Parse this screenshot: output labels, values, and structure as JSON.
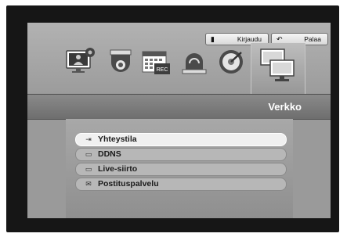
{
  "header": {
    "login_label": "Kirjaudu",
    "back_label": "Palaa"
  },
  "section_title": "Verkko",
  "menu_items": [
    {
      "label": "Yhteystila",
      "icon": "login-arrow-icon",
      "active": true
    },
    {
      "label": "DDNS",
      "icon": "network-card-icon",
      "active": false
    },
    {
      "label": "Live-siirto",
      "icon": "network-card-icon",
      "active": false
    },
    {
      "label": "Postituspalvelu",
      "icon": "mail-icon",
      "active": false
    }
  ],
  "top_icons": [
    "monitor-settings-icon",
    "camera-dome-icon",
    "calendar-rec-icon",
    "alarm-siren-icon",
    "hdd-disk-icon",
    "network-monitors-icon"
  ],
  "rec_text": "REC",
  "colors": {
    "accent": "#ffffff",
    "panel": "#9a9a9a",
    "frame": "#161616"
  }
}
